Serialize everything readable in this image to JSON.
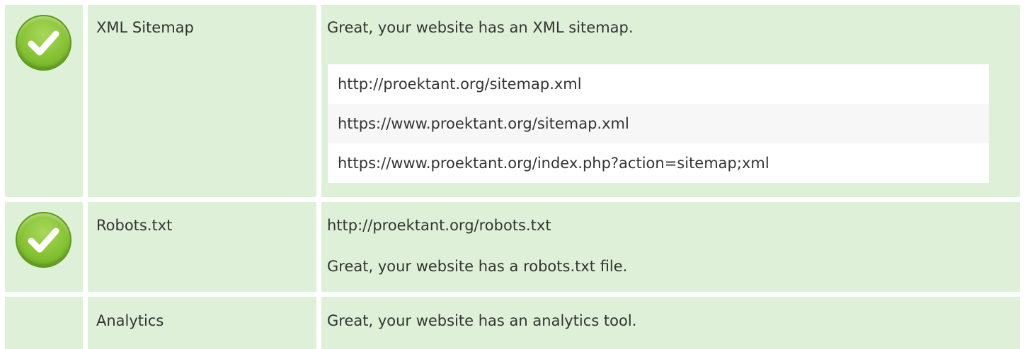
{
  "rows": [
    {
      "status": "pass",
      "icon": "check-circle-icon",
      "label": "XML Sitemap",
      "message": "Great, your website has an XML sitemap.",
      "urls": [
        "http://proektant.org/sitemap.xml",
        "https://www.proektant.org/sitemap.xml",
        "https://www.proektant.org/index.php?action=sitemap;xml"
      ]
    },
    {
      "status": "pass",
      "icon": "check-circle-icon",
      "label": "Robots.txt",
      "url": "http://proektant.org/robots.txt",
      "message": "Great, your website has a robots.txt file."
    },
    {
      "status": "none",
      "label": "Analytics",
      "message": "Great, your website has an analytics tool."
    }
  ],
  "colors": {
    "row_background": "#dff0d8",
    "check_green": "#86c234",
    "text": "#333333"
  }
}
